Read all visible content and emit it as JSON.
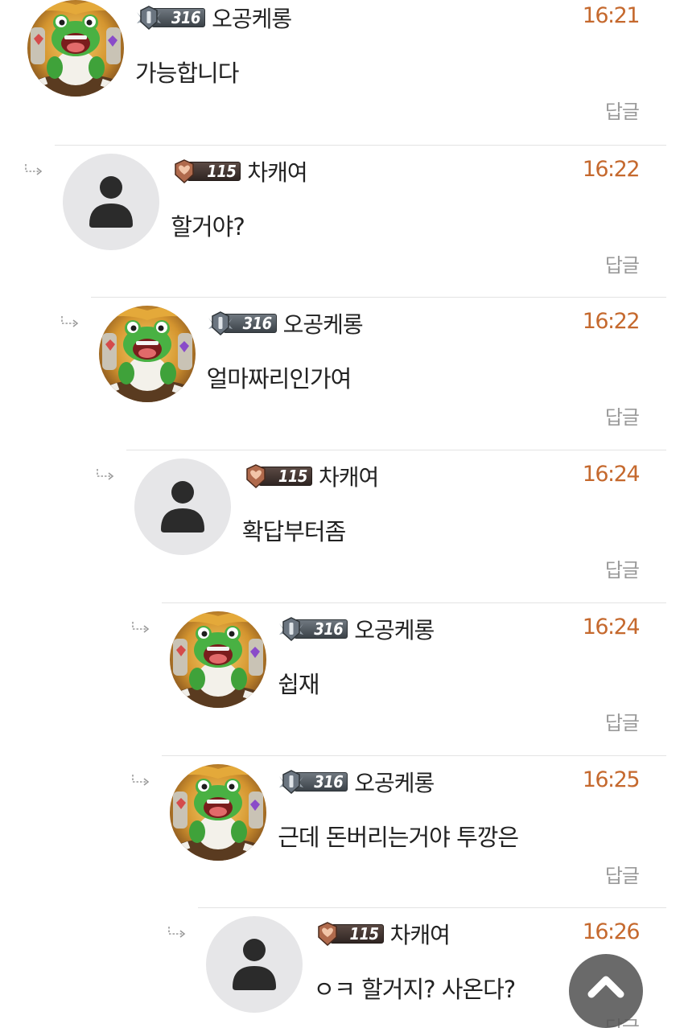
{
  "comments": [
    {
      "depth": 0,
      "avatar": "frog-avatar",
      "level": "316",
      "badge_tier": "silver",
      "nickname": "오공케롱",
      "time": "16:21",
      "text": "가능합니다",
      "reply_label": "답글"
    },
    {
      "depth": 1,
      "avatar": "default-user-avatar",
      "level": "115",
      "badge_tier": "bronze",
      "nickname": "차캐여",
      "time": "16:22",
      "text": "할거야?",
      "reply_label": "답글"
    },
    {
      "depth": 2,
      "avatar": "frog-avatar",
      "level": "316",
      "badge_tier": "silver",
      "nickname": "오공케롱",
      "time": "16:22",
      "text": "얼마짜리인가여",
      "reply_label": "답글"
    },
    {
      "depth": 3,
      "avatar": "default-user-avatar",
      "level": "115",
      "badge_tier": "bronze",
      "nickname": "차캐여",
      "time": "16:24",
      "text": "확답부터좀",
      "reply_label": "답글"
    },
    {
      "depth": 4,
      "avatar": "frog-avatar",
      "level": "316",
      "badge_tier": "silver",
      "nickname": "오공케롱",
      "time": "16:24",
      "text": "쉽재",
      "reply_label": "답글"
    },
    {
      "depth": 4,
      "avatar": "frog-avatar",
      "level": "316",
      "badge_tier": "silver",
      "nickname": "오공케롱",
      "time": "16:25",
      "text": "근데 돈버리는거야 투깡은",
      "reply_label": "답글"
    },
    {
      "depth": 5,
      "avatar": "default-user-avatar",
      "level": "115",
      "badge_tier": "bronze",
      "nickname": "차캐여",
      "time": "16:26",
      "text": "ㅇㅋ 할거지? 사온다?",
      "reply_label": "답글"
    }
  ],
  "colors": {
    "time": "#c5692e",
    "nickname": "#222222",
    "reply_label": "#9a9a9a",
    "divider": "#e3e3e3",
    "default_avatar_bg": "#e6e6e8",
    "scroll_top_bg": "#555555"
  },
  "scroll_top_button": {
    "icon": "chevron-up-icon"
  }
}
